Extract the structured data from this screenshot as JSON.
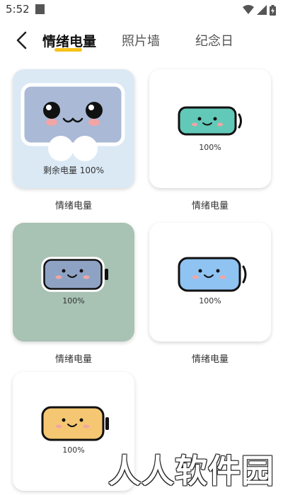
{
  "status_bar": {
    "time": "5:52"
  },
  "header": {
    "tabs": [
      {
        "label": "情绪电量",
        "active": true
      },
      {
        "label": "照片墙",
        "active": false
      },
      {
        "label": "纪念日",
        "active": false
      }
    ],
    "accent_color": "#f6c21b"
  },
  "widgets": [
    {
      "caption": "情绪电量",
      "percent_text": "剩余电量  100%",
      "level": 1.0,
      "card_bg": "#dbe9f5",
      "battery_fill": "#a9b9d6"
    },
    {
      "caption": "情绪电量",
      "percent_text": "100%",
      "level": 1.0,
      "card_bg": "#ffffff",
      "battery_fill": "#62c9b8"
    },
    {
      "caption": "情绪电量",
      "percent_text": "100%",
      "level": 1.0,
      "card_bg": "#a8c2b4",
      "battery_fill": "#8ea3c4"
    },
    {
      "caption": "情绪电量",
      "percent_text": "100%",
      "level": 1.0,
      "card_bg": "#ffffff",
      "battery_fill": "#8fc3f2"
    },
    {
      "caption": "",
      "percent_text": "100%",
      "level": 1.0,
      "card_bg": "#ffffff",
      "battery_fill": "#f5c772"
    }
  ],
  "watermark": "人人软件园"
}
